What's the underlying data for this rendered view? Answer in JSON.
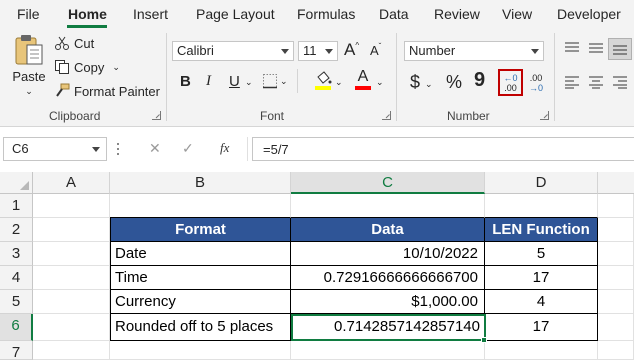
{
  "menu": {
    "items": [
      "File",
      "Home",
      "Insert",
      "Page Layout",
      "Formulas",
      "Data",
      "Review",
      "View",
      "Developer"
    ],
    "active": "Home"
  },
  "ribbon": {
    "clipboard": {
      "paste_label": "Paste",
      "cut_label": "Cut",
      "copy_label": "Copy",
      "format_painter_label": "Format Painter",
      "group_label": "Clipboard"
    },
    "font": {
      "font_name": "Calibri",
      "font_size": "11",
      "bold": "B",
      "italic": "I",
      "underline": "U",
      "grow": "A",
      "shrink": "A",
      "font_color_letter": "A",
      "group_label": "Font",
      "highlight_color": "#ffff00",
      "font_color": "#ff0000"
    },
    "number": {
      "format": "Number",
      "currency": "$",
      "percent": "%",
      "comma": "9",
      "increase_decimal_top": "←0",
      "increase_decimal_bottom": ".00",
      "decrease_decimal_top": ".00",
      "decrease_decimal_bottom": "→0",
      "group_label": "Number",
      "highlight_border": "#c00000"
    }
  },
  "formula_bar": {
    "name_box": "C6",
    "cancel": "✕",
    "enter": "✓",
    "fx": "fx",
    "formula": "=5/7"
  },
  "sheet": {
    "columns": [
      "A",
      "B",
      "C",
      "D"
    ],
    "rows": [
      "1",
      "2",
      "3",
      "4",
      "5",
      "6",
      "7"
    ],
    "selected_cell": "C6",
    "header_fill": "#2f5597",
    "table": {
      "headers": [
        "Format",
        "Data",
        "LEN Function"
      ],
      "rows": [
        [
          "Date",
          "10/10/2022",
          "5"
        ],
        [
          "Time",
          "0.72916666666666700",
          "17"
        ],
        [
          "Currency",
          "$1,000.00",
          "4"
        ],
        [
          "Rounded off to 5 places",
          "0.7142857142857140",
          "17"
        ]
      ]
    }
  }
}
